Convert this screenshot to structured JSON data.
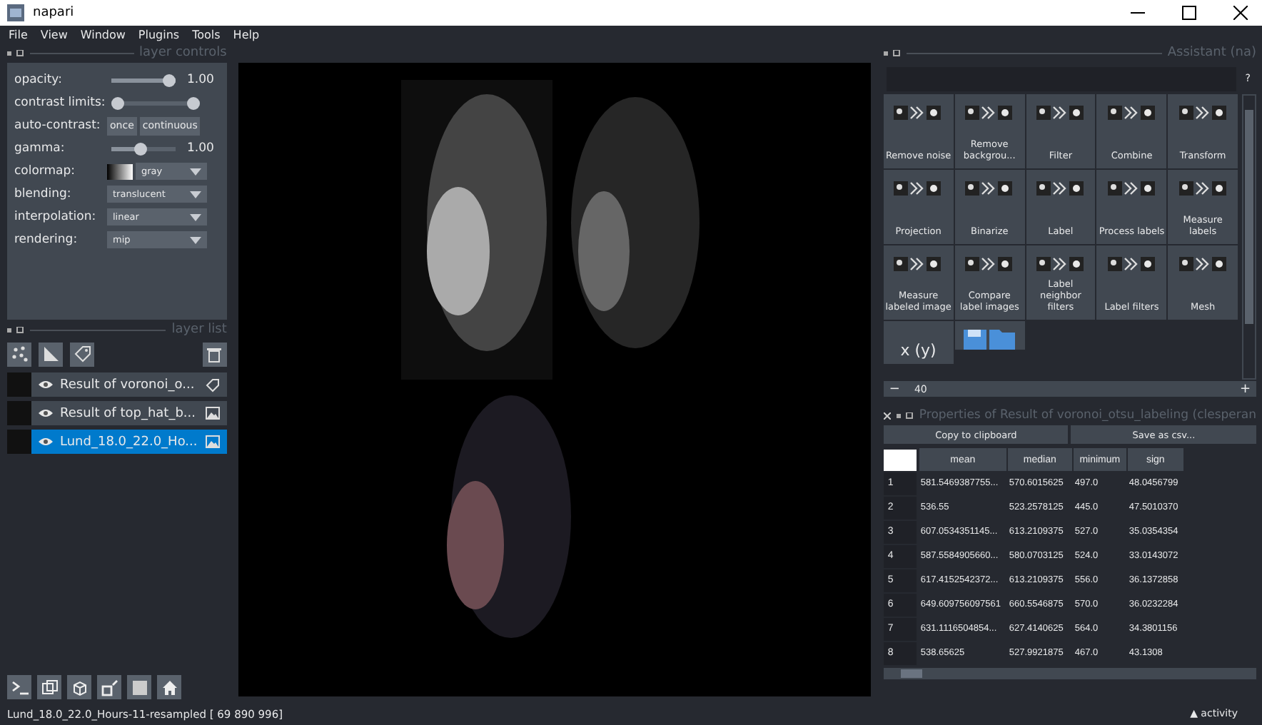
{
  "window": {
    "title": "napari"
  },
  "menu": [
    "File",
    "View",
    "Window",
    "Plugins",
    "Tools",
    "Help"
  ],
  "layer_controls": {
    "title": "layer controls",
    "rows": [
      {
        "kind": "slider",
        "label": "opacity:",
        "level": 1,
        "value": "1.00"
      },
      {
        "kind": "range",
        "label": "contrast limits:",
        "thumbs": [
          {
            "level": 0
          },
          {
            "level": 1
          }
        ]
      },
      {
        "kind": "buttons",
        "label": "auto-contrast:",
        "buttons": [
          "once",
          "continuous"
        ]
      },
      {
        "kind": "slider",
        "label": "gamma:",
        "level": 0.45,
        "value": "1.00"
      },
      {
        "kind": "colormap",
        "label": "colormap:",
        "value": "gray"
      },
      {
        "kind": "dropdown",
        "label": "blending:",
        "value": "translucent"
      },
      {
        "kind": "dropdown",
        "label": "interpolation:",
        "value": "linear"
      },
      {
        "kind": "dropdown",
        "label": "rendering:",
        "value": "mip"
      }
    ]
  },
  "layer_list": {
    "title": "layer list",
    "layers": [
      {
        "name": "Result of voronoi_o...",
        "kind": "labels",
        "visible": true,
        "selected": false
      },
      {
        "name": "Result of top_hat_b...",
        "kind": "image",
        "visible": true,
        "selected": false
      },
      {
        "name": "Lund_18.0_22.0_Ho...",
        "kind": "image",
        "visible": true,
        "selected": true
      }
    ]
  },
  "assistant": {
    "title": "Assistant (na)",
    "help": "?",
    "tools": [
      {
        "kind": "tool",
        "label": "Remove noise"
      },
      {
        "kind": "tool",
        "label": "Remove backgrou..."
      },
      {
        "kind": "tool",
        "label": "Filter"
      },
      {
        "kind": "tool",
        "label": "Combine"
      },
      {
        "kind": "tool",
        "label": "Transform"
      },
      {
        "kind": "tool",
        "label": "Projection"
      },
      {
        "kind": "tool",
        "label": "Binarize"
      },
      {
        "kind": "tool",
        "label": "Label"
      },
      {
        "kind": "tool",
        "label": "Process labels"
      },
      {
        "kind": "tool",
        "label": "Measure labels"
      },
      {
        "kind": "tool",
        "label": "Measure labeled image"
      },
      {
        "kind": "tool",
        "label": "Compare label images"
      },
      {
        "kind": "tool",
        "label": "Label neighbor filters"
      },
      {
        "kind": "tool",
        "label": "Label filters"
      },
      {
        "kind": "tool",
        "label": "Mesh"
      },
      {
        "kind": "text",
        "label": "x (y)"
      },
      {
        "kind": "save"
      }
    ],
    "zoom": {
      "minus": "−",
      "value": "40",
      "plus": "+"
    }
  },
  "properties": {
    "title": "Properties of Result of voronoi_otsu_labeling (clesperan",
    "buttons": [
      "Copy to clipboard",
      "Save as csv..."
    ],
    "columns": [
      "mean",
      "median",
      "minimum",
      "sign"
    ],
    "rows": [
      {
        "index": "1",
        "cells": [
          "581.5469387755...",
          "570.6015625",
          "497.0",
          "48.0456799"
        ]
      },
      {
        "index": "2",
        "cells": [
          "536.55",
          "523.2578125",
          "445.0",
          "47.5010370"
        ]
      },
      {
        "index": "3",
        "cells": [
          "607.0534351145...",
          "613.2109375",
          "527.0",
          "35.0354354"
        ]
      },
      {
        "index": "4",
        "cells": [
          "587.5584905660...",
          "580.0703125",
          "524.0",
          "33.0143072"
        ]
      },
      {
        "index": "5",
        "cells": [
          "617.4152542372...",
          "613.2109375",
          "556.0",
          "36.1372858"
        ]
      },
      {
        "index": "6",
        "cells": [
          "649.609756097561",
          "660.5546875",
          "570.0",
          "36.0232284"
        ]
      },
      {
        "index": "7",
        "cells": [
          "631.1116504854...",
          "627.4140625",
          "564.0",
          "34.3801156"
        ]
      },
      {
        "index": "8",
        "cells": [
          "538.65625",
          "527.9921875",
          "467.0",
          "43.1308"
        ]
      }
    ]
  },
  "status_bar": {
    "text": "Lund_18.0_22.0_Hours-11-resampled [ 69 890 996]",
    "activity": "▲ activity"
  }
}
